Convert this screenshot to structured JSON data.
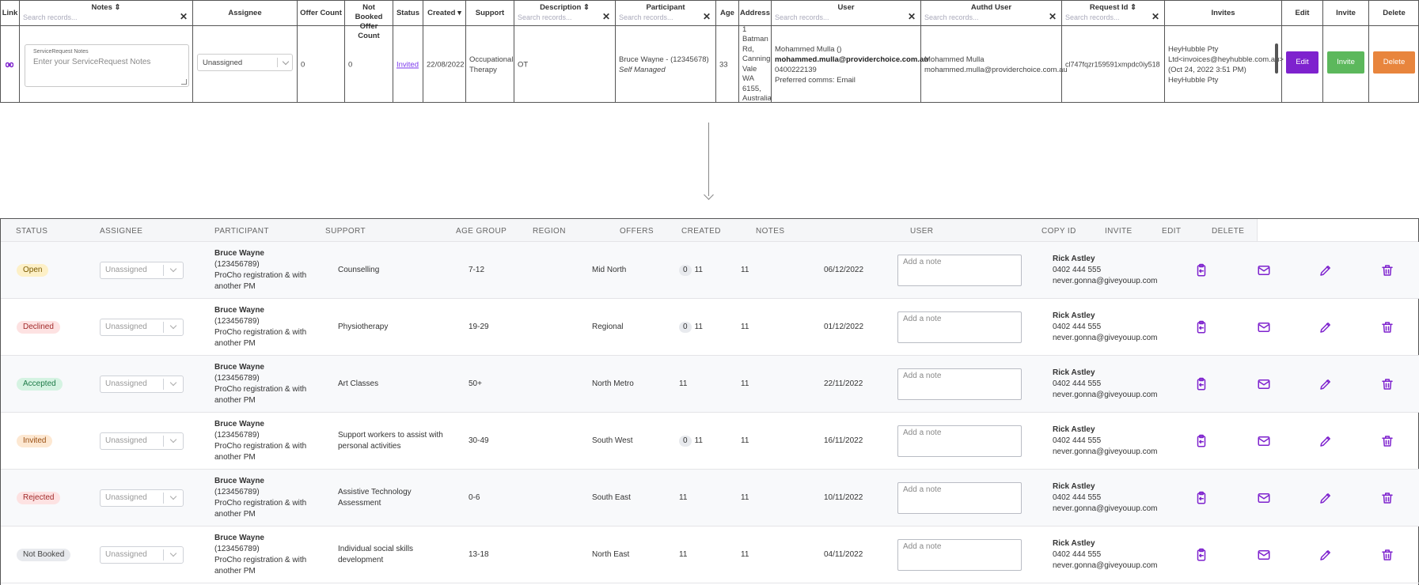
{
  "old_table": {
    "columns": [
      {
        "key": "link",
        "title": "Link",
        "sort": ""
      },
      {
        "key": "notes",
        "title": "Notes",
        "sort": "⇕",
        "search": "Search records...",
        "clear": "✕"
      },
      {
        "key": "assignee",
        "title": "Assignee"
      },
      {
        "key": "offer_count",
        "title": "Offer Count"
      },
      {
        "key": "not_booked",
        "title": "Not Booked Offer Count"
      },
      {
        "key": "status",
        "title": "Status"
      },
      {
        "key": "created",
        "title": "Created",
        "sort": "▾"
      },
      {
        "key": "support",
        "title": "Support"
      },
      {
        "key": "description",
        "title": "Description",
        "sort": "⇕",
        "search": "Search records...",
        "clear": "✕"
      },
      {
        "key": "participant",
        "title": "Participant",
        "search": "Search records...",
        "clear": "✕"
      },
      {
        "key": "age",
        "title": "Age"
      },
      {
        "key": "address",
        "title": "Address"
      },
      {
        "key": "user",
        "title": "User",
        "search": "Search records...",
        "clear": "✕"
      },
      {
        "key": "authd_user",
        "title": "Authd User",
        "search": "Search records...",
        "clear": "✕"
      },
      {
        "key": "request_id",
        "title": "Request Id",
        "sort": "⇕",
        "search": "Search records...",
        "clear": "✕"
      },
      {
        "key": "invites",
        "title": "Invites"
      },
      {
        "key": "edit",
        "title": "Edit"
      },
      {
        "key": "invite",
        "title": "Invite"
      },
      {
        "key": "delete",
        "title": "Delete"
      }
    ],
    "row": {
      "notes_label": "ServiceRequest Notes",
      "notes_placeholder": "Enter your ServiceRequest Notes",
      "assignee": "Unassigned",
      "offer_count": "0",
      "not_booked_count": "0",
      "status": "Invited",
      "created": "22/08/2022",
      "support": "Occupational Therapy",
      "description": "OT",
      "participant_name": "Bruce Wayne - (12345678)",
      "participant_plan": "Self Managed",
      "age": "33",
      "address": "1 Batman Rd, Canning Vale WA 6155, Australia",
      "user_name": "Mohammed Mulla ()",
      "user_email": "mohammed.mulla@providerchoice.com.au",
      "user_phone": "0400222139",
      "user_comms": "Preferred comms: Email",
      "authd_name": "Mohammed Mulla",
      "authd_email": "mohammed.mulla@providerchoice.com.au",
      "request_id": "cl747fqzr159591xmpdc0iy518",
      "invites_text": "HeyHubble Pty Ltd<invoices@heyhubble.com.au> (Oct 24, 2022 3:51 PM) HeyHubble Pty",
      "edit_label": "Edit",
      "invite_label": "Invite",
      "delete_label": "Delete"
    }
  },
  "new_table": {
    "headers": {
      "status": "STATUS",
      "assignee": "ASSIGNEE",
      "participant": "PARTICIPANT",
      "support": "SUPPORT",
      "age_group": "AGE GROUP",
      "region": "REGION",
      "offers": "OFFERS",
      "created": "CREATED",
      "notes": "NOTES",
      "user": "USER",
      "copy_id": "COPY ID",
      "invite": "INVITE",
      "edit": "EDIT",
      "delete": "DELETE"
    },
    "note_placeholder": "Add a note",
    "rows": [
      {
        "status": "Open",
        "status_bg": "#fdf0c7",
        "status_fg": "#7a5a00",
        "assignee": "Unassigned",
        "participant_name": "Bruce Wayne",
        "participant_id": "(123456789)",
        "participant_desc": "ProCho registration & with another PM",
        "support": "Counselling",
        "age_group": "7-12",
        "region": "Mid North",
        "offers_pill": "0",
        "offers": "11",
        "count": "11",
        "created": "06/12/2022",
        "user_name": "Rick Astley",
        "user_phone": "0402 444 555",
        "user_email": "never.gonna@giveyouup.com"
      },
      {
        "status": "Declined",
        "status_bg": "#fde2e2",
        "status_fg": "#a12b2b",
        "assignee": "Unassigned",
        "participant_name": "Bruce Wayne",
        "participant_id": "(123456789)",
        "participant_desc": "ProCho registration & with another PM",
        "support": "Physiotherapy",
        "age_group": "19-29",
        "region": "Regional",
        "offers_pill": "0",
        "offers": "11",
        "count": "11",
        "created": "01/12/2022",
        "user_name": "Rick Astley",
        "user_phone": "0402 444 555",
        "user_email": "never.gonna@giveyouup.com"
      },
      {
        "status": "Accepted",
        "status_bg": "#d5f3e2",
        "status_fg": "#1e7a48",
        "assignee": "Unassigned",
        "participant_name": "Bruce Wayne",
        "participant_id": "(123456789)",
        "participant_desc": "ProCho registration & with another PM",
        "support": "Art Classes",
        "age_group": "50+",
        "region": "North Metro",
        "offers_pill": "",
        "offers": "11",
        "count": "11",
        "created": "22/11/2022",
        "user_name": "Rick Astley",
        "user_phone": "0402 444 555",
        "user_email": "never.gonna@giveyouup.com"
      },
      {
        "status": "Invited",
        "status_bg": "#fde8d2",
        "status_fg": "#9a4f12",
        "assignee": "Unassigned",
        "participant_name": "Bruce Wayne",
        "participant_id": "(123456789)",
        "participant_desc": "ProCho registration & with another PM",
        "support": "Support workers to assist with personal activities",
        "age_group": "30-49",
        "region": "South West",
        "offers_pill": "0",
        "offers": "11",
        "count": "11",
        "created": "16/11/2022",
        "user_name": "Rick Astley",
        "user_phone": "0402 444 555",
        "user_email": "never.gonna@giveyouup.com"
      },
      {
        "status": "Rejected",
        "status_bg": "#fde2e2",
        "status_fg": "#a12b2b",
        "assignee": "Unassigned",
        "participant_name": "Bruce Wayne",
        "participant_id": "(123456789)",
        "participant_desc": "ProCho registration & with another PM",
        "support": "Assistive Technology Assessment",
        "age_group": "0-6",
        "region": "South East",
        "offers_pill": "",
        "offers": "11",
        "count": "11",
        "created": "10/11/2022",
        "user_name": "Rick Astley",
        "user_phone": "0402 444 555",
        "user_email": "never.gonna@giveyouup.com"
      },
      {
        "status": "Not Booked",
        "status_bg": "#e8eaee",
        "status_fg": "#444444",
        "assignee": "Unassigned",
        "participant_name": "Bruce Wayne",
        "participant_id": "(123456789)",
        "participant_desc": "ProCho registration & with another PM",
        "support": "Individual social skills development",
        "age_group": "13-18",
        "region": "North East",
        "offers_pill": "",
        "offers": "11",
        "count": "11",
        "created": "04/11/2022",
        "user_name": "Rick Astley",
        "user_phone": "0402 444 555",
        "user_email": "never.gonna@giveyouup.com"
      }
    ],
    "icons": {
      "copy": "clipboard-copy-icon",
      "invite": "mail-icon",
      "edit": "pencil-icon",
      "delete": "trash-icon"
    },
    "accent": "#7e22ce"
  }
}
